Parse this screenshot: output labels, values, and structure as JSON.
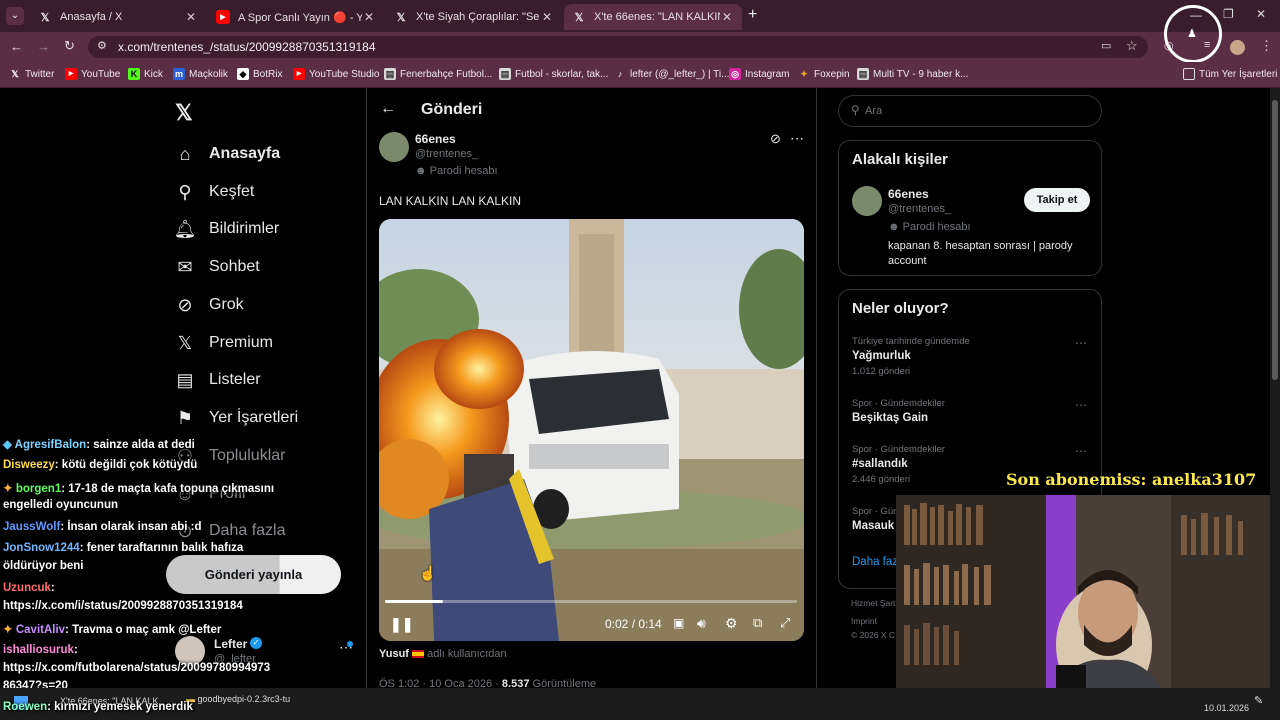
{
  "browser": {
    "tabs": [
      {
        "title": "Anasayfa / X",
        "icon": "x-logo-icon",
        "active": false
      },
      {
        "title": "A Spor Canlı Yayın 🔴 - You",
        "icon": "youtube-icon",
        "active": false
      },
      {
        "title": "X'te Siyah Çoraplılar: \"Serdar A",
        "icon": "x-logo-icon",
        "active": false
      },
      {
        "title": "X'te 66enes: \"LAN KALKIN",
        "icon": "x-logo-icon",
        "active": true
      }
    ],
    "new_tab": "+",
    "url": "x.com/trentenes_/status/2009928870351319184",
    "bookmarks": [
      "Twitter",
      "YouTube",
      "Kick",
      "Maçkolik",
      "BotRix",
      "YouTube Studio",
      "Fenerbahçe Futbol...",
      "Futbol - skorlar, tak...",
      "lefter (@_lefter_) | Ti...",
      "Instagram",
      "Foxepin",
      "Multi TV - 9 haber k..."
    ],
    "all_bookmarks": "Tüm Yer İşaretleri"
  },
  "nav": {
    "items": [
      "Anasayfa",
      "Keşfet",
      "Bildirimler",
      "Sohbet",
      "Grok",
      "Premium",
      "Listeler",
      "Yer İşaretleri",
      "Topluluklar",
      "Profil",
      "Daha fazla"
    ],
    "post_button": "Gönderi yayınla",
    "account": {
      "name": "Lefter",
      "handle": "@_lefter_"
    }
  },
  "post": {
    "header": "Gönderi",
    "author": "66enes",
    "handle": "@trentenes_",
    "badge": "Parodi hesabı",
    "text": "LAN KALKIN LAN KALKIN",
    "video": {
      "time": "0:02 / 0:14",
      "progress": 0.14
    },
    "caption_user": "Yusuf",
    "caption_rest": "adlı kullanıcıdan",
    "meta_date": "ÖS 1:02 · 10 Oca 2026 ·",
    "meta_views_num": "8.537",
    "meta_views_label": "Görüntüleme"
  },
  "right": {
    "search_placeholder": "Ara",
    "related_title": "Alakalı kişiler",
    "related": {
      "name": "66enes",
      "handle": "@trentenes_",
      "badge": "Parodi hesabı",
      "bio": "kapanan 8. hesaptan sonrası | parody account",
      "follow": "Takip et"
    },
    "trends_title": "Neler oluyor?",
    "trends": [
      {
        "context": "Türkiye tarihinde gündemde",
        "name": "Yağmurluk",
        "count": "1.012 gönderi"
      },
      {
        "context": "Spor · Gündemdekiler",
        "name": "Beşiktaş Gain",
        "count": ""
      },
      {
        "context": "Spor · Gündemdekiler",
        "name": "#sallandık",
        "count": "2.446 gönderi"
      },
      {
        "context": "Spor · Gün",
        "name": "Masauk",
        "count": ""
      }
    ],
    "more": "Daha faz",
    "footer1": "Hizmet Şart",
    "footer2": "Imprint",
    "footer3": "© 2026 X C"
  },
  "overlay": {
    "last_sub": "Son abonemiss: anelka3107",
    "chat": [
      {
        "user": "AgresifBalon",
        "color": "#7fd3ff",
        "msg": ": sainze alda at dedi"
      },
      {
        "user": "Disweezy",
        "color": "#ffd84d",
        "msg": ": kötü değildi çok kötüydü"
      },
      {
        "user": "borgen1",
        "color": "#5cff5c",
        "msg": ": 17-18 de maçta kafa topuna çıkmasını"
      },
      {
        "user": "",
        "color": "#fff",
        "msg": "engelledi oyuncunun"
      },
      {
        "user": "JaussWolf",
        "color": "#5a9bff",
        "msg": ": İnsan olarak insan abi :d"
      },
      {
        "user": "JonSnow1244",
        "color": "#6fb7ff",
        "msg": ": fener taraftarının balık hafıza"
      },
      {
        "user": "",
        "color": "#fff",
        "msg": "öldürüyor beni"
      },
      {
        "user": "Uzuncuk",
        "color": "#ff6b6b",
        "msg": ":"
      },
      {
        "user": "",
        "color": "#fff",
        "msg": "https://x.com/i/status/2009928870351319184"
      },
      {
        "user": "CavitAliv",
        "color": "#c58cff",
        "msg": ": Travma o maç amk @Lefter"
      },
      {
        "user": "ishalliosuruk",
        "color": "#ff8ad8",
        "msg": ":"
      },
      {
        "user": "",
        "color": "#fff",
        "msg": "https://x.com/futbolarena/status/20099780994973"
      },
      {
        "user": "",
        "color": "#fff",
        "msg": "86347?s=20"
      },
      {
        "user": "Roewen",
        "color": "#8affc5",
        "msg": ": kırmızı yemesek yenerdik"
      }
    ]
  },
  "taskbar": {
    "items": [
      "X'te 66enes: \"LAN KALK",
      "goodbyedpi-0.2.3rc3-tu"
    ],
    "date": "10.01.2026"
  }
}
